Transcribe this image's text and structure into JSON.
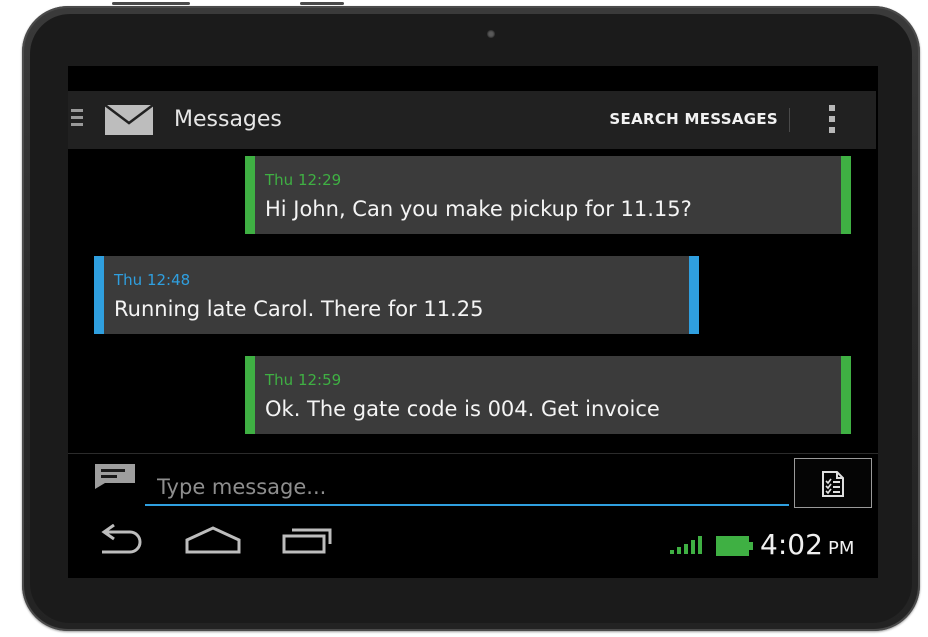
{
  "actionbar": {
    "title": "Messages",
    "search_label": "SEARCH MESSAGES",
    "app_icon": "envelope-icon",
    "menu_icon": "drawer-menu-icon",
    "overflow_icon": "overflow-menu-icon"
  },
  "messages": [
    {
      "time": "Thu 12:29",
      "text": "Hi John, Can you make pickup for 11.15?",
      "direction": "outgoing",
      "color": "#3fb043"
    },
    {
      "time": "Thu 12:48",
      "text": "Running late Carol. There for 11.25",
      "direction": "incoming",
      "color": "#2f9fdf"
    },
    {
      "time": "Thu 12:59",
      "text": "Ok. The gate code is 004. Get invoice",
      "direction": "outgoing",
      "color": "#3fb043"
    }
  ],
  "compose": {
    "placeholder": "Type message...",
    "value": "",
    "compose_icon": "compose-message-icon",
    "attach_icon": "document-list-icon"
  },
  "navbar": {
    "back_icon": "back-icon",
    "home_icon": "home-icon",
    "recents_icon": "recent-apps-icon"
  },
  "status": {
    "time": "4:02",
    "ampm": "PM",
    "signal_icon": "signal-icon",
    "battery_icon": "battery-icon",
    "accent": "#3fb043"
  }
}
